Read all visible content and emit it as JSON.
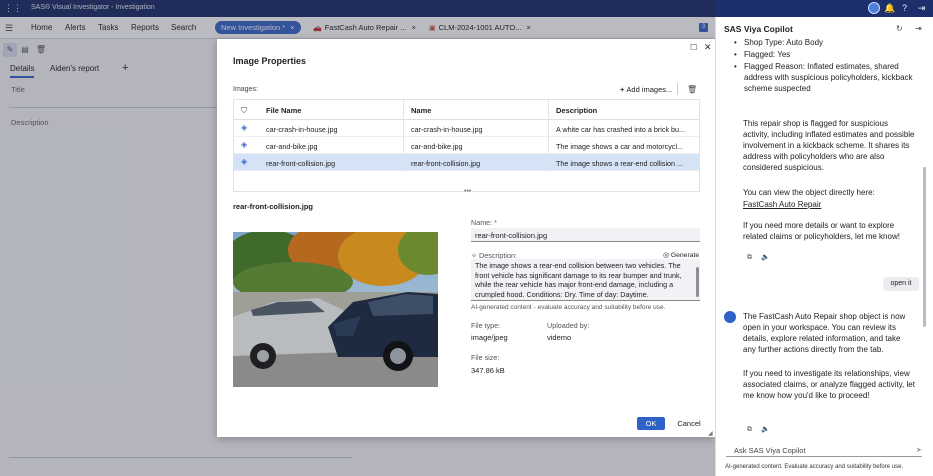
{
  "app": {
    "title": "SAS® Visual Investigator - Investigation",
    "icons": [
      "grid-icon",
      "search-icon",
      "bell-icon",
      "help-icon",
      "avatar",
      "exit-icon"
    ]
  },
  "nav": {
    "items": [
      "Home",
      "Alerts",
      "Tasks",
      "Reports",
      "Search"
    ],
    "tabs": [
      {
        "label": "New Investigation *",
        "active": true
      },
      {
        "label": "FastCash Auto Repair ...",
        "active": false
      },
      {
        "label": "CLM-2024-1001 AUTO...",
        "active": false
      }
    ],
    "count": "3"
  },
  "workspace": {
    "subtabs": [
      "Details",
      "Aiden's report"
    ],
    "add": "+",
    "fields": [
      "Title",
      "Description"
    ]
  },
  "dialog": {
    "title": "Image Properties",
    "images_label": "Images:",
    "add_images": "Add images...",
    "columns": [
      "File Name",
      "Name",
      "Description"
    ],
    "rows": [
      {
        "file": "car-crash-in-house.jpg",
        "name": "car-crash-in-house.jpg",
        "desc": "A white car has crashed into a brick bu...",
        "selected": false
      },
      {
        "file": "car-and-bike.jpg",
        "name": "car-and-bike.jpg",
        "desc": "The image shows a car and motorcycl...",
        "selected": false
      },
      {
        "file": "rear-front-collision.jpg",
        "name": "rear-front-collision.jpg",
        "desc": "The image shows a rear-end collision ...",
        "selected": true
      }
    ],
    "detail": {
      "title": "rear-front-collision.jpg",
      "name_label": "Name:",
      "name_value": "rear-front-collision.jpg",
      "desc_label": "Description:",
      "generate": "Generate",
      "desc_value": "The image shows a rear-end collision between two vehicles. The front vehicle has significant damage to its rear bumper and trunk, while the rear vehicle has major front-end damage, including a crumpled hood. Conditions: Dry. Time of day: Daytime.",
      "ai_note": "AI-generated content - evaluate accuracy and suitability before use.",
      "file_type_label": "File type:",
      "file_type": "image/jpeg",
      "uploaded_by_label": "Uploaded by:",
      "uploaded_by": "videmo",
      "file_size_label": "File size:",
      "file_size": "347.86 kB"
    },
    "ok": "OK",
    "cancel": "Cancel"
  },
  "copilot": {
    "title": "SAS Viya Copilot",
    "bullets": [
      "Shop Type: Auto Body",
      "Flagged: Yes",
      "Flagged Reason: Inflated estimates, shared address with suspicious policyholders, kickback scheme suspected"
    ],
    "para1": "This repair shop is flagged for suspicious activity, including inflated estimates and possible involvement in a kickback scheme. It shares its address with policyholders who are also considered suspicious.",
    "para2": "You can view the object directly here:",
    "link": "FastCash Auto Repair",
    "para3": "If you need more details or want to explore related claims or policyholders, let me know!",
    "user_msg": "open it",
    "para4": "The FastCash Auto Repair shop object is now open in your workspace. You can review its details, explore related information, and take any further actions directly from the tab.",
    "para5": "If you need to investigate its relationships, view associated claims, or analyze flagged activity, let me know how you'd like to proceed!",
    "input_placeholder": "Ask SAS Viya Copilot",
    "footer": "AI-generated content. Evaluate accuracy and suitability before use."
  }
}
